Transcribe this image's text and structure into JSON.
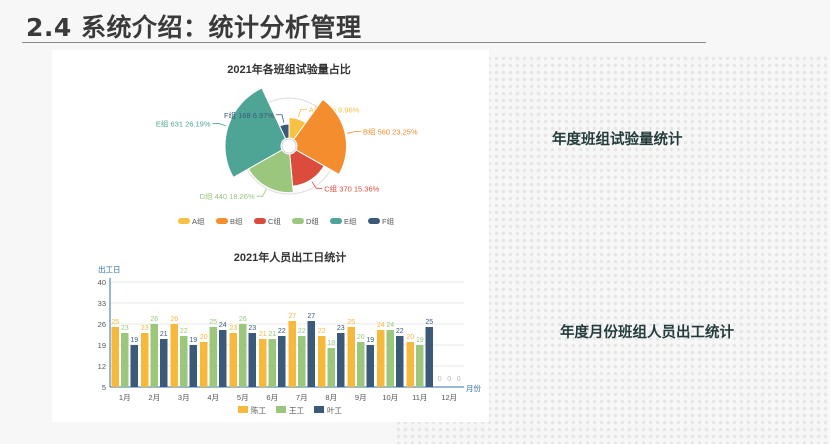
{
  "slide": {
    "title": "2.4 系统介绍：统计分析管理",
    "captions": [
      "年度班组试验量统计",
      "年度月份班组人员出工统计"
    ]
  },
  "chart_data": [
    {
      "type": "pie",
      "variant": "rose",
      "title": "2021年各班组试验量占比",
      "legend_position": "bottom",
      "slices": [
        {
          "name": "A组",
          "value": 240,
          "percent": "9.96%",
          "label": "A组 240 9.96%",
          "color": "#f7c143"
        },
        {
          "name": "B组",
          "value": 560,
          "percent": "23.25%",
          "label": "B组 560 23.25%",
          "color": "#f38d2e"
        },
        {
          "name": "C组",
          "value": 370,
          "percent": "15.36%",
          "label": "C组 370 15.36%",
          "color": "#dc4c3c"
        },
        {
          "name": "D组",
          "value": 440,
          "percent": "18.26%",
          "label": "D组 440 18.26%",
          "color": "#9ac67d"
        },
        {
          "name": "E组",
          "value": 631,
          "percent": "26.19%",
          "label": "E组 631 26.19%",
          "color": "#4ea596"
        },
        {
          "name": "F组",
          "value": 168,
          "percent": "6.97%",
          "label": "F组 168 6.97%",
          "color": "#3b5a7a"
        }
      ]
    },
    {
      "type": "bar",
      "title": "2021年人员出工日统计",
      "ylabel": "出工日",
      "xlabel": "月份",
      "ylim": [
        5,
        40
      ],
      "yticks": [
        5,
        12,
        19,
        26,
        33,
        40
      ],
      "grid": true,
      "legend_position": "bottom",
      "categories": [
        "1月",
        "2月",
        "3月",
        "4月",
        "5月",
        "6月",
        "7月",
        "8月",
        "9月",
        "10月",
        "11月",
        "12月"
      ],
      "series": [
        {
          "name": "陈工",
          "color": "#f6b93b",
          "values": [
            25,
            23,
            26,
            20,
            23,
            21,
            27,
            22,
            25,
            24,
            20,
            0
          ]
        },
        {
          "name": "王工",
          "color": "#9bc77d",
          "values": [
            23,
            26,
            22,
            25,
            26,
            21,
            22,
            18,
            20,
            24,
            19,
            0
          ]
        },
        {
          "name": "叶工",
          "color": "#3b5a7a",
          "values": [
            19,
            21,
            19,
            24,
            23,
            22,
            27,
            23,
            19,
            22,
            25,
            0
          ]
        }
      ]
    }
  ]
}
